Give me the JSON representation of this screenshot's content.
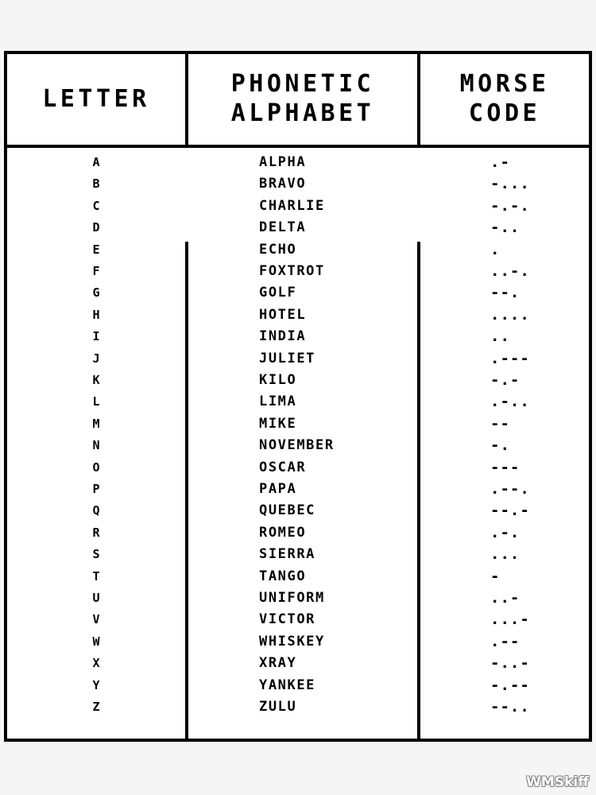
{
  "poster": {
    "background_color": "#f5f5f5",
    "card_background": "#ffffff",
    "border_color": "#000000",
    "watermark": "WMSkiff"
  },
  "table": {
    "headers": {
      "letter": [
        "LETTER"
      ],
      "phonetic": [
        "PHONETIC",
        "ALPHABET"
      ],
      "morse": [
        "MORSE",
        "CODE"
      ]
    },
    "columns": [
      "LETTER",
      "PHONETIC ALPHABET",
      "MORSE CODE"
    ],
    "rows": [
      {
        "letter": "A",
        "phonetic": "ALPHA",
        "morse": ".-"
      },
      {
        "letter": "B",
        "phonetic": "BRAVO",
        "morse": "-..."
      },
      {
        "letter": "C",
        "phonetic": "CHARLIE",
        "morse": "-.-."
      },
      {
        "letter": "D",
        "phonetic": "DELTA",
        "morse": "-.."
      },
      {
        "letter": "E",
        "phonetic": "ECHO",
        "morse": "."
      },
      {
        "letter": "F",
        "phonetic": "FOXTROT",
        "morse": "..-."
      },
      {
        "letter": "G",
        "phonetic": "GOLF",
        "morse": "--."
      },
      {
        "letter": "H",
        "phonetic": "HOTEL",
        "morse": "...."
      },
      {
        "letter": "I",
        "phonetic": "INDIA",
        "morse": ".."
      },
      {
        "letter": "J",
        "phonetic": "JULIET",
        "morse": ".---"
      },
      {
        "letter": "K",
        "phonetic": "KILO",
        "morse": "-.-"
      },
      {
        "letter": "L",
        "phonetic": "LIMA",
        "morse": ".-.."
      },
      {
        "letter": "M",
        "phonetic": "MIKE",
        "morse": "--"
      },
      {
        "letter": "N",
        "phonetic": "NOVEMBER",
        "morse": "-."
      },
      {
        "letter": "O",
        "phonetic": "OSCAR",
        "morse": "---"
      },
      {
        "letter": "P",
        "phonetic": "PAPA",
        "morse": ".--."
      },
      {
        "letter": "Q",
        "phonetic": "QUEBEC",
        "morse": "--.-"
      },
      {
        "letter": "R",
        "phonetic": "ROMEO",
        "morse": ".-."
      },
      {
        "letter": "S",
        "phonetic": "SIERRA",
        "morse": "..."
      },
      {
        "letter": "T",
        "phonetic": "TANGO",
        "morse": "-"
      },
      {
        "letter": "U",
        "phonetic": "UNIFORM",
        "morse": "..-"
      },
      {
        "letter": "V",
        "phonetic": "VICTOR",
        "morse": "...-"
      },
      {
        "letter": "W",
        "phonetic": "WHISKEY",
        "morse": ".--"
      },
      {
        "letter": "X",
        "phonetic": "XRAY",
        "morse": "-..-"
      },
      {
        "letter": "Y",
        "phonetic": "YANKEE",
        "morse": "-.--"
      },
      {
        "letter": "Z",
        "phonetic": "ZULU",
        "morse": "--.."
      }
    ]
  }
}
